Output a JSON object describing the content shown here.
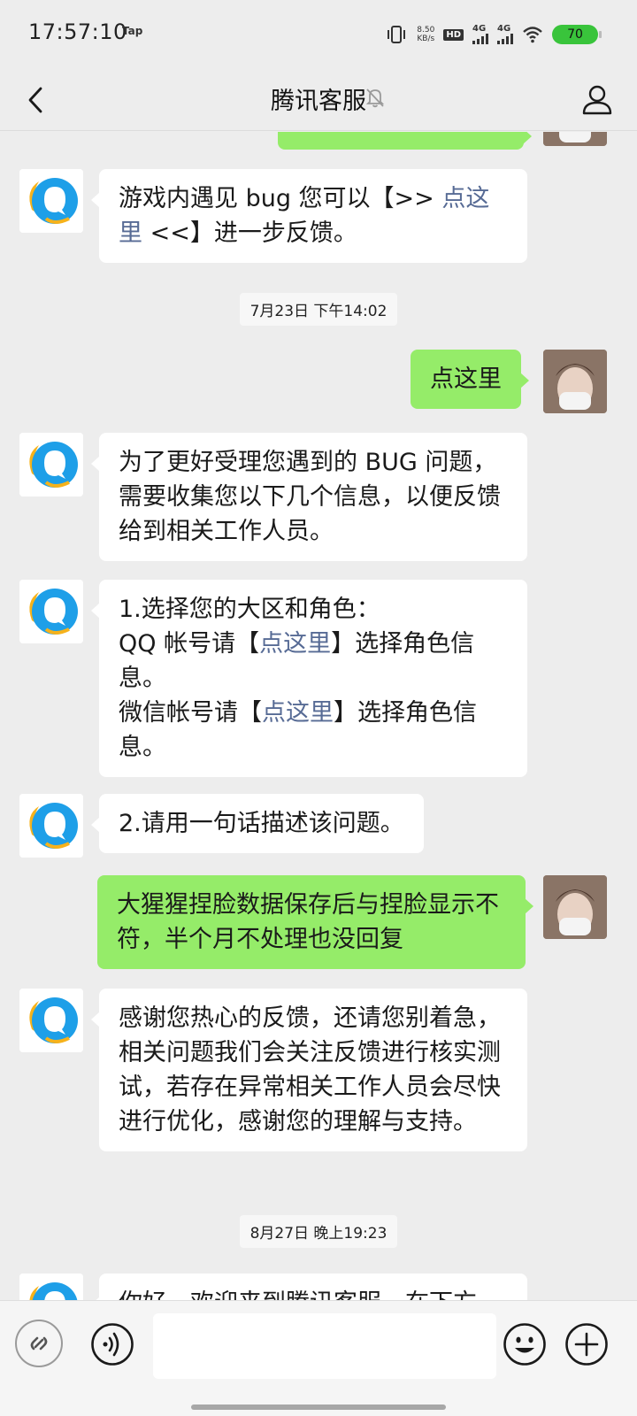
{
  "status_bar": {
    "time": "17:57:10",
    "carrier_tag": "Tap",
    "net_speed_value": "8.50",
    "net_speed_unit": "KB/s",
    "hd_badge": "HD",
    "signal1": "4G",
    "signal2": "4G",
    "battery": "70"
  },
  "header": {
    "title": "腾讯客服",
    "back_icon": "back-arrow-icon",
    "mute_icon": "bell-muted-icon",
    "profile_icon": "person-icon"
  },
  "messages": [
    {
      "from": "bot",
      "parts": [
        {
          "t": "游戏内遇见 bug 您可以【>> "
        },
        {
          "t": "点这里",
          "link": true
        },
        {
          "t": " <<】进一步反馈。"
        }
      ]
    },
    {
      "type": "time",
      "text": "7月23日 下午14:02"
    },
    {
      "from": "me",
      "parts": [
        {
          "t": "点这里"
        }
      ]
    },
    {
      "from": "bot",
      "parts": [
        {
          "t": "为了更好受理您遇到的 BUG 问题，需要收集您以下几个信息，以便反馈给到相关工作人员。"
        }
      ]
    },
    {
      "from": "bot",
      "parts": [
        {
          "t": "1.选择您的大区和角色：\nQQ 帐号请【"
        },
        {
          "t": "点这里",
          "link": true
        },
        {
          "t": "】选择角色信息。\n微信帐号请【"
        },
        {
          "t": "点这里",
          "link": true
        },
        {
          "t": "】选择角色信息。"
        }
      ]
    },
    {
      "from": "bot",
      "parts": [
        {
          "t": "2.请用一句话描述该问题。"
        }
      ]
    },
    {
      "from": "me",
      "parts": [
        {
          "t": "大猩猩捏脸数据保存后与捏脸显示不符，半个月不处理也没回复"
        }
      ]
    },
    {
      "from": "bot",
      "parts": [
        {
          "t": "感谢您热心的反馈，还请您别着急，相关问题我们会关注反馈进行核实测试，若存在异常相关工作人员会尽快进行优化，感谢您的理解与支持。"
        }
      ]
    },
    {
      "type": "time",
      "text": "8月27日 晚上19:23"
    },
    {
      "from": "bot",
      "parts": [
        {
          "t": "你好，欢迎来到腾讯客服，在下方"
        }
      ]
    }
  ],
  "input_bar": {
    "mini_program_icon": "link-icon",
    "voice_icon": "voice-icon",
    "emoji_icon": "smiley-icon",
    "plus_icon": "plus-icon",
    "input_value": ""
  },
  "colors": {
    "background": "#ededed",
    "bot_bubble": "#ffffff",
    "my_bubble": "#95ec69",
    "link": "#576b95"
  }
}
